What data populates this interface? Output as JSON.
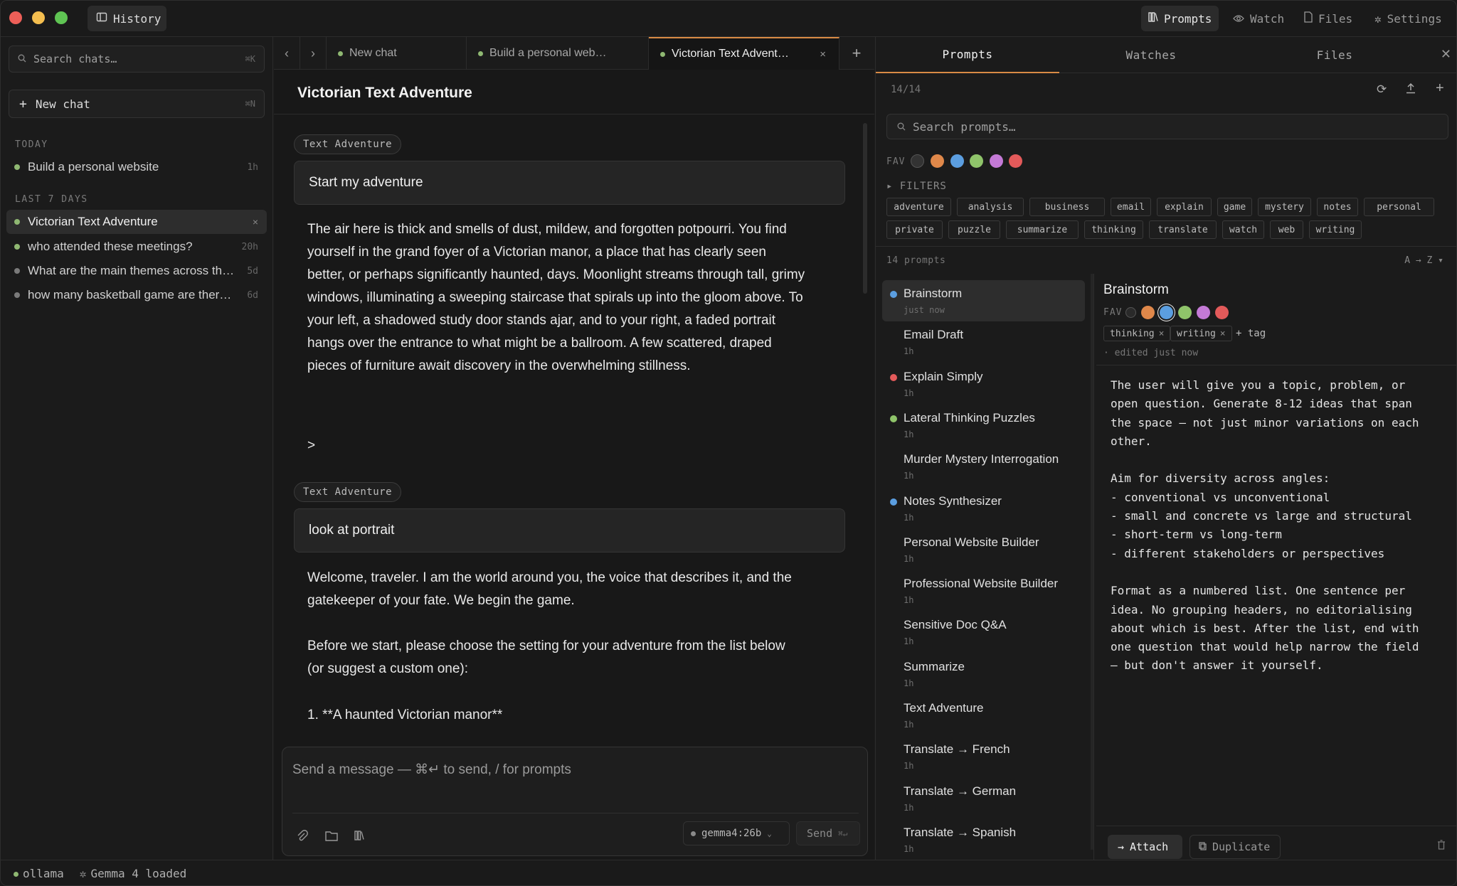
{
  "colors": {
    "accent": "#d88a45",
    "green": "#8fb872",
    "gray_dot": "#7a7a7a"
  },
  "titlebar": {
    "history_label": "History",
    "nav": [
      {
        "label": "Prompts",
        "icon": "library-icon"
      },
      {
        "label": "Watch",
        "icon": "eye-icon"
      },
      {
        "label": "Files",
        "icon": "file-icon"
      },
      {
        "label": "Settings",
        "icon": "gear-icon"
      }
    ]
  },
  "sidebar": {
    "search_placeholder": "Search chats…",
    "search_kbd": "⌘K",
    "new_chat_label": "New chat",
    "new_chat_kbd": "⌘N",
    "today_label": "TODAY",
    "last7_label": "LAST 7 DAYS",
    "today": [
      {
        "title": "Build a personal website",
        "age": "1h"
      }
    ],
    "last7": [
      {
        "title": "Victorian Text Adventure",
        "age": "",
        "active": true
      },
      {
        "title": "who attended these meetings?",
        "age": "20h"
      },
      {
        "title": "What are the main themes across th…",
        "age": "5d"
      },
      {
        "title": "how many basketball game are ther…",
        "age": "6d"
      }
    ]
  },
  "tabs": [
    {
      "label": "New chat"
    },
    {
      "label": "Build a personal web…"
    },
    {
      "label": "Victorian Text Advent…",
      "active": true
    }
  ],
  "chat": {
    "title": "Victorian Text Adventure",
    "badge1": "Text Adventure",
    "user1": "Start my adventure",
    "assistant1": "The air here is thick and smells of dust, mildew, and forgotten potpourri. You find yourself in the grand foyer of a Victorian manor, a place that has clearly seen better, or perhaps significantly haunted, days. Moonlight streams through tall, grimy windows, illuminating a sweeping staircase that spirals up into the gloom above. To your left, a shadowed study door stands ajar, and to your right, a faded portrait hangs over the entrance to what might be a ballroom. A few scattered, draped pieces of furniture await discovery in the overwhelming stillness.",
    "prompt_char": ">",
    "badge2": "Text Adventure",
    "user2": "look at portrait",
    "assistant2_p1": "Welcome, traveler. I am the world around you, the voice that describes it, and the gatekeeper of your fate. We begin the game.",
    "assistant2_p2": "Before we start, please choose the setting for your adventure from the list below (or suggest a custom one):",
    "assistant2_p3": "1. **A haunted Victorian manor**"
  },
  "composer": {
    "placeholder": "Send a message  —  ⌘↵ to send, / for prompts",
    "model": "gemma4:26b",
    "send_label": "Send",
    "send_kbd": "⌘↵"
  },
  "right": {
    "tabs": [
      "Prompts",
      "Watches",
      "Files"
    ],
    "count": "14/14",
    "search_placeholder": "Search prompts…",
    "fav_label": "FAV",
    "fav_colors": [
      "#e0884a",
      "#5b9ee0",
      "#8fc46a",
      "#c47ad6",
      "#e35a5a"
    ],
    "filters_label": "▸ FILTERS",
    "filter_chips": [
      "adventure",
      "analysis",
      "business",
      "email",
      "explain",
      "game",
      "mystery",
      "notes",
      "personal",
      "private",
      "puzzle",
      "summarize",
      "thinking",
      "translate",
      "watch",
      "web",
      "writing"
    ],
    "prompts_count": "14 prompts",
    "sort_label": "A → Z ▾",
    "prompts": [
      {
        "name": "Brainstorm",
        "time": "just now",
        "dot": "#5b9ee0",
        "active": true
      },
      {
        "name": "Email Draft",
        "time": "1h",
        "dot": ""
      },
      {
        "name": "Explain Simply",
        "time": "1h",
        "dot": "#e35a5a"
      },
      {
        "name": "Lateral Thinking Puzzles",
        "time": "1h",
        "dot": "#8fc46a"
      },
      {
        "name": "Murder Mystery Interrogation",
        "time": "1h",
        "dot": ""
      },
      {
        "name": "Notes Synthesizer",
        "time": "1h",
        "dot": "#5b9ee0"
      },
      {
        "name": "Personal Website Builder",
        "time": "1h",
        "dot": ""
      },
      {
        "name": "Professional Website Builder",
        "time": "1h",
        "dot": ""
      },
      {
        "name": "Sensitive Doc Q&A",
        "time": "1h",
        "dot": ""
      },
      {
        "name": "Summarize",
        "time": "1h",
        "dot": ""
      },
      {
        "name": "Text Adventure",
        "time": "1h",
        "dot": ""
      },
      {
        "name": "Translate → French",
        "time": "1h",
        "dot": ""
      },
      {
        "name": "Translate → German",
        "time": "1h",
        "dot": ""
      },
      {
        "name": "Translate → Spanish",
        "time": "1h",
        "dot": ""
      }
    ],
    "detail": {
      "title": "Brainstorm",
      "fav_label": "FAV",
      "selected_color": "#5b9ee0",
      "tags": [
        "thinking",
        "writing"
      ],
      "add_tag": "+ tag",
      "edited": "· edited just now",
      "body": "The user will give you a topic, problem, or\nopen question. Generate 8-12 ideas that span\nthe space — not just minor variations on each\nother.\n\nAim for diversity across angles:\n- conventional vs unconventional\n- small and concrete vs large and structural\n- short-term vs long-term\n- different stakeholders or perspectives\n\nFormat as a numbered list. One sentence per\nidea. No grouping headers, no editorialising\nabout which is best. After the list, end with\none question that would help narrow the field\n— but don't answer it yourself.",
      "attach_label": "Attach",
      "duplicate_label": "Duplicate"
    }
  },
  "status": {
    "backend": "ollama",
    "model_status": "Gemma 4 loaded"
  }
}
